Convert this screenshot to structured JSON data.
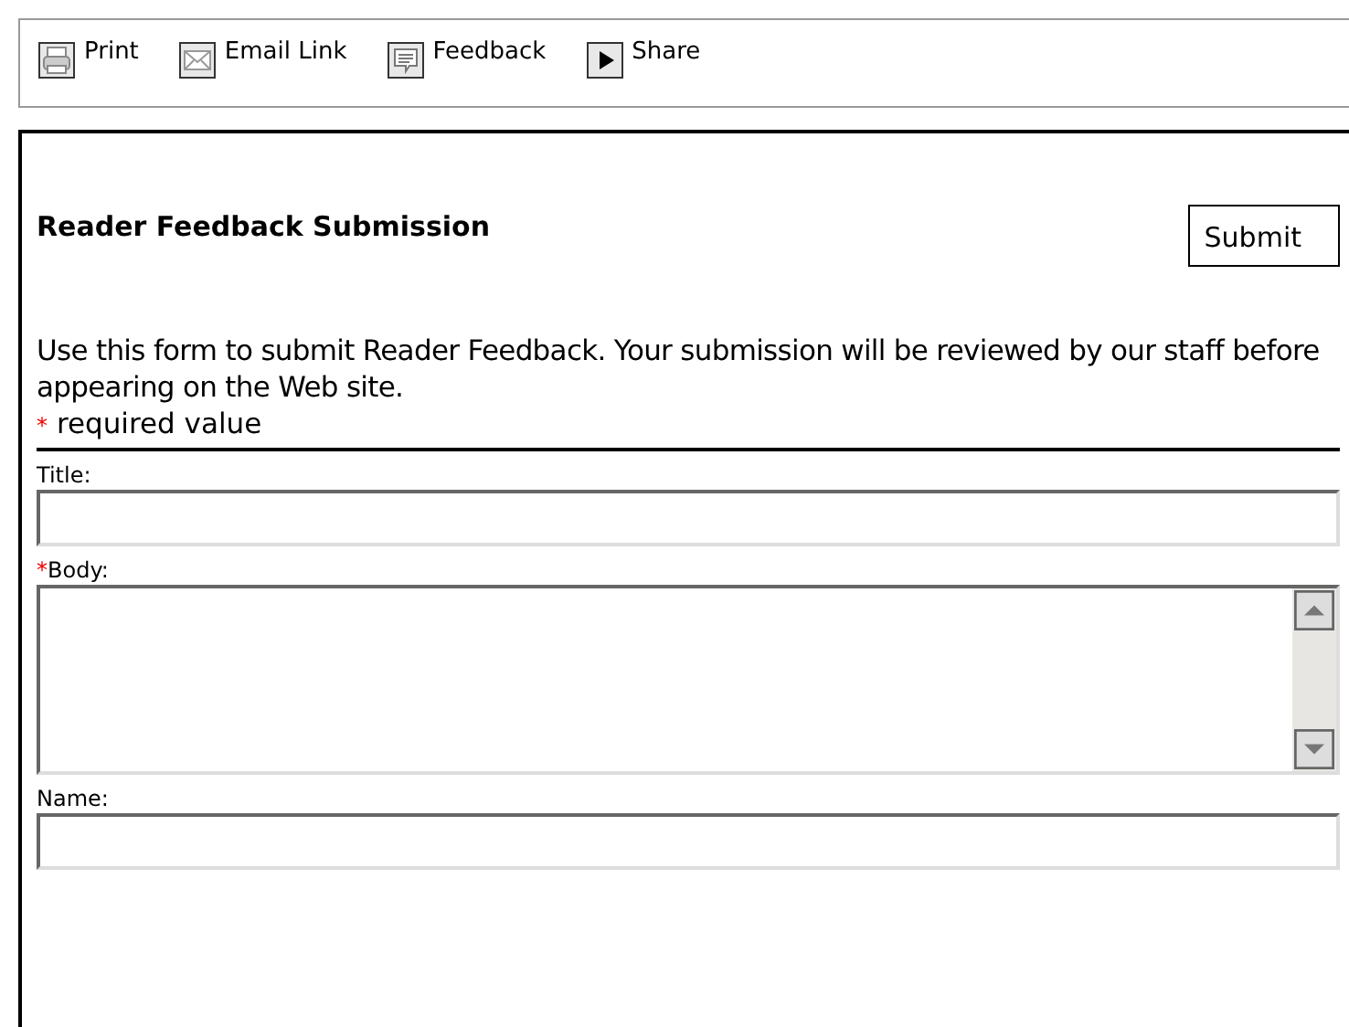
{
  "toolbar": [
    {
      "kind": "printer",
      "label": "Print"
    },
    {
      "kind": "envelope",
      "label": "Email Link"
    },
    {
      "kind": "comment",
      "label": "Feedback"
    },
    {
      "kind": "play",
      "label": "Share"
    }
  ],
  "form": {
    "title": "Reader Feedback Submission",
    "submit": "Submit",
    "intro": "Use this form to submit Reader Feedback. Your submission will be reviewed by our staff before appearing on the Web site.",
    "required_mark": "*",
    "required_note": "required value",
    "fields": [
      {
        "kind": "input",
        "label": "Title:",
        "required": false
      },
      {
        "kind": "textarea",
        "label": "Body:",
        "required": true
      },
      {
        "kind": "input",
        "label": "Name:",
        "required": false
      }
    ]
  }
}
